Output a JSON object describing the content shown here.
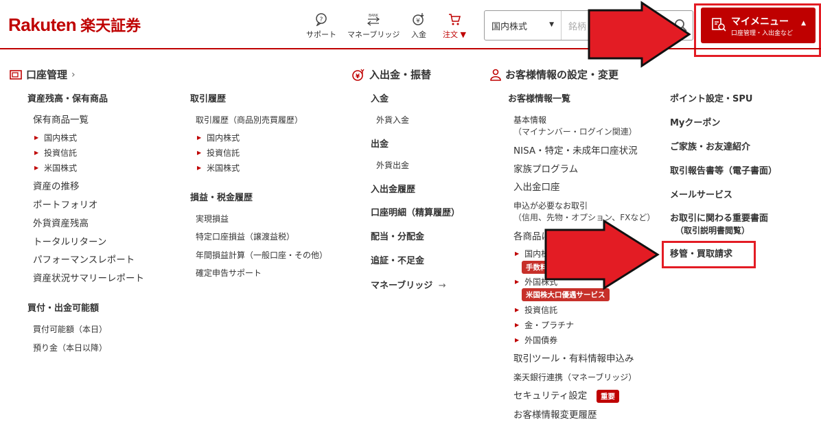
{
  "header": {
    "logo_en": "Rakuten",
    "logo_jp": "楽天証券",
    "nav": {
      "support": "サポート",
      "money_bridge": "マネーブリッジ",
      "deposit": "入金",
      "order": "注文 ▼"
    },
    "search": {
      "category": "国内株式",
      "placeholder": "銘柄"
    },
    "mymenu": {
      "title": "マイメニュー",
      "subtitle": "口座管理・入出金など"
    }
  },
  "menu": {
    "account": {
      "heading": "口座管理",
      "chevron": "›",
      "col1": {
        "holdings_head": "資産残高・保有商品",
        "holdings_list": "保有商品一覧",
        "domestic_stock": "国内株式",
        "investment_trust": "投資信託",
        "us_stock": "米国株式",
        "asset_trend": "資産の推移",
        "portfolio": "ポートフォリオ",
        "fx_balance": "外貨資産残高",
        "total_return": "トータルリターン",
        "performance_report": "パフォーマンスレポート",
        "asset_summary_report": "資産状況サマリーレポート",
        "buying_power_head": "買付・出金可能額",
        "buying_power_today": "買付可能額（本日）",
        "deposit_after_today": "預り金（本日以降）"
      },
      "col2": {
        "history_head": "取引履歴",
        "history_detail": "取引履歴（商品別売買履歴）",
        "domestic_stock": "国内株式",
        "investment_trust": "投資信託",
        "us_stock": "米国株式",
        "pnl_head": "損益・税金履歴",
        "realized_pnl": "実現損益",
        "specific_account_pnl": "特定口座損益（譲渡益税）",
        "annual_pnl": "年間損益計算（一般口座・その他）",
        "tax_return_support": "確定申告サポート"
      }
    },
    "deposit_withdraw": {
      "heading": "入出金・振替",
      "deposit_head": "入金",
      "fx_deposit": "外貨入金",
      "withdraw_head": "出金",
      "fx_withdraw": "外貨出金",
      "history_head": "入出金履歴",
      "statement_head": "口座明細（精算履歴）",
      "dividend_head": "配当・分配金",
      "margin_head": "追証・不足金",
      "money_bridge_head": "マネーブリッジ",
      "money_bridge_arrow": "→"
    },
    "customer": {
      "heading": "お客様情報の設定・変更",
      "list_head": "お客様情報一覧",
      "basic_info": "基本情報",
      "basic_info_note": "（マイナンバー・ログイン関連）",
      "nisa": "NISA・特定・未成年口座状況",
      "family_program": "家族プログラム",
      "deposit_account": "入出金口座",
      "app_required": "申込が必要なお取引",
      "app_required_note": "（信用、先物・オプション、FXなど）",
      "product_settings": "各商品に関する設定",
      "domestic_stock": "国内株式",
      "fee_course_badge": "手数料コース",
      "foreign_stock": "外国株式",
      "us_stock_service_badge": "米国株大口優遇サービス",
      "investment_trust": "投資信託",
      "gold_platinum": "金・プラチナ",
      "foreign_bonds": "外国債券",
      "trading_tools": "取引ツール・有料情報申込み",
      "rakuten_bank": "楽天銀行連携（マネーブリッジ）",
      "security_settings": "セキュリティ設定",
      "important_badge": "重要",
      "change_history": "お客様情報変更履歴"
    },
    "col5": {
      "points_spu": "ポイント設定・SPU",
      "my_coupon": "Myクーポン",
      "family_referral": "ご家族・お友達紹介",
      "report_docs": "取引報告書等（電子書面）",
      "mail_service": "メールサービス",
      "important_docs": "お取引に関わる重要書面",
      "important_docs_note": "（取引説明書閲覧）",
      "transfer_request": "移管・買取請求"
    }
  },
  "colors": {
    "brand": "#bf0000",
    "annotation_arrow": "#e31c24",
    "badge": "#c7302a"
  }
}
